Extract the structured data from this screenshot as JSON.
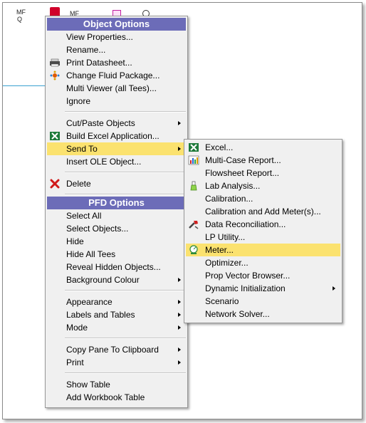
{
  "background": {
    "label_a": "MF",
    "label_b": "Q",
    "label_c": "MF"
  },
  "colors": {
    "header_bg": "#6c6cb8",
    "highlight": "#fbe26f",
    "menu_bg": "#f0f0f0"
  },
  "object_options": {
    "header": "Object Options",
    "items": [
      {
        "label": "View Properties...",
        "icon": ""
      },
      {
        "label": "Rename...",
        "icon": ""
      },
      {
        "label": "Print Datasheet...",
        "icon": "printer-icon"
      },
      {
        "label": "Change Fluid Package...",
        "icon": "fluid-package-icon"
      },
      {
        "label": "Multi Viewer (all Tees)...",
        "icon": ""
      },
      {
        "label": "Ignore",
        "icon": ""
      },
      {
        "label": "Cut/Paste Objects",
        "icon": "",
        "submenu": true
      },
      {
        "label": "Build Excel Application...",
        "icon": "excel-icon"
      },
      {
        "label": "Send To",
        "icon": "",
        "submenu": true,
        "highlighted": true
      },
      {
        "label": "Insert OLE Object...",
        "icon": ""
      },
      {
        "label": "Delete",
        "icon": "delete-x-icon"
      }
    ]
  },
  "pfd_options": {
    "header": "PFD Options",
    "items": [
      {
        "label": "Select All"
      },
      {
        "label": "Select Objects..."
      },
      {
        "label": "Hide"
      },
      {
        "label": "Hide All Tees"
      },
      {
        "label": "Reveal Hidden Objects..."
      },
      {
        "label": "Background Colour",
        "submenu": true
      },
      {
        "label": "Appearance",
        "submenu": true
      },
      {
        "label": "Labels and Tables",
        "submenu": true
      },
      {
        "label": "Mode",
        "submenu": true
      },
      {
        "label": "Copy Pane To Clipboard",
        "submenu": true
      },
      {
        "label": "Print",
        "submenu": true
      },
      {
        "label": "Show Table"
      },
      {
        "label": "Add Workbook Table"
      }
    ]
  },
  "send_to": {
    "items": [
      {
        "label": "Excel...",
        "icon": "excel-icon"
      },
      {
        "label": "Multi-Case Report...",
        "icon": "report-chart-icon"
      },
      {
        "label": "Flowsheet Report...",
        "icon": ""
      },
      {
        "label": "Lab Analysis...",
        "icon": "lab-flask-icon"
      },
      {
        "label": "Calibration...",
        "icon": ""
      },
      {
        "label": "Calibration and Add Meter(s)...",
        "icon": ""
      },
      {
        "label": "Data Reconciliation...",
        "icon": "data-reconciliation-icon"
      },
      {
        "label": "LP Utility...",
        "icon": ""
      },
      {
        "label": "Meter...",
        "icon": "meter-icon",
        "highlighted": true
      },
      {
        "label": "Optimizer...",
        "icon": ""
      },
      {
        "label": "Prop Vector Browser...",
        "icon": ""
      },
      {
        "label": "Dynamic Initialization",
        "icon": "",
        "submenu": true
      },
      {
        "label": "Scenario",
        "icon": ""
      },
      {
        "label": "Network Solver...",
        "icon": ""
      }
    ]
  }
}
